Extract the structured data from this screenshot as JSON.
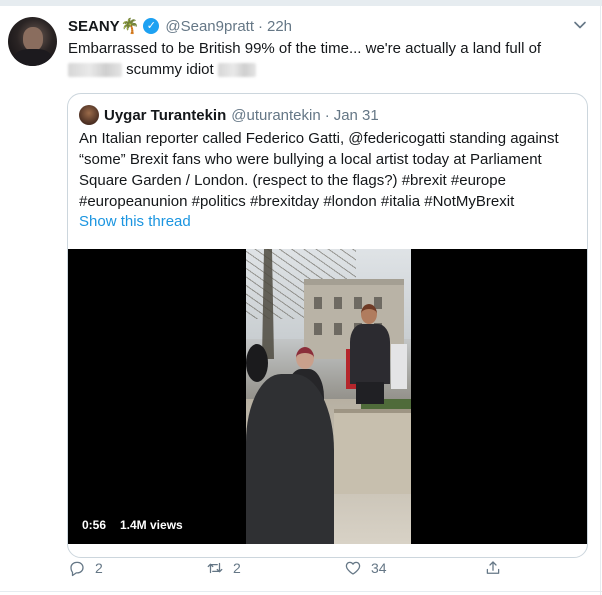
{
  "tweet": {
    "display_name": "SEANY",
    "name_emoji": "🌴",
    "handle": "@Sean9pratt",
    "separator": "·",
    "time": "22h",
    "text_line1": "Embarrassed to be British 99% of the time... we're actually a land full of",
    "text_line2_visible": "scummy idiot"
  },
  "quoted_tweet": {
    "display_name": "Uygar Turantekin",
    "handle": "@uturantekin",
    "separator": "·",
    "date": "Jan 31",
    "text": [
      "An Italian reporter called Federico Gatti, @federicogatti standing against",
      "“some” Brexit fans who were bullying a local artist today at Parliament",
      "Square Garden / London. (respect to the flags?) #brexit #europe",
      "#europeanunion #politics #brexitday #london #italia #NotMyBrexit"
    ],
    "show_thread": "Show this thread",
    "video": {
      "duration": "0:56",
      "views": "1.4M views"
    }
  },
  "actions": {
    "reply_count": "2",
    "retweet_count": "2",
    "like_count": "34"
  },
  "icons": [
    "verified-icon",
    "chevron-down-icon",
    "reply-icon",
    "retweet-icon",
    "like-icon",
    "share-icon"
  ],
  "colors": {
    "link": "#1b95e0",
    "verified": "#1da1f2",
    "secondary_text": "#657786",
    "border": "#ccd6dd"
  }
}
